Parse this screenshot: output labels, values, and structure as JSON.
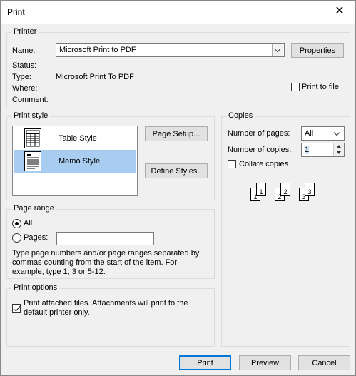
{
  "window": {
    "title": "Print"
  },
  "printer": {
    "group_label": "Printer",
    "name_label": "Name:",
    "name_value": "Microsoft Print to PDF",
    "properties_label": "Properties",
    "status_label": "Status:",
    "type_label": "Type:",
    "type_value": "Microsoft Print To PDF",
    "where_label": "Where:",
    "comment_label": "Comment:",
    "print_to_file_label": "Print to file",
    "print_to_file_checked": false
  },
  "print_style": {
    "group_label": "Print style",
    "styles": [
      {
        "label": "Table Style",
        "selected": false,
        "icon": "table-style-icon"
      },
      {
        "label": "Memo Style",
        "selected": true,
        "icon": "memo-style-icon"
      }
    ],
    "page_setup_label": "Page Setup...",
    "define_styles_label": "Define Styles.."
  },
  "copies": {
    "group_label": "Copies",
    "number_of_pages_label": "Number of pages:",
    "number_of_pages_value": "All",
    "number_of_copies_label": "Number of copies:",
    "number_of_copies_value": "1",
    "collate_label": "Collate copies",
    "collate_checked": false,
    "collate_pages": [
      "1",
      "1",
      "2",
      "2",
      "3",
      "3"
    ]
  },
  "page_range": {
    "group_label": "Page range",
    "all_label": "All",
    "pages_label": "Pages:",
    "selected": "all",
    "help_text": "Type page numbers and/or page ranges separated by commas counting from the start of the item.  For example, type 1, 3 or 5-12."
  },
  "print_options": {
    "group_label": "Print options",
    "print_attached_label": "Print attached files.  Attachments will print to the default printer only.",
    "print_attached_checked": true
  },
  "footer": {
    "print_label": "Print",
    "preview_label": "Preview",
    "cancel_label": "Cancel"
  },
  "colors": {
    "selection": "#a8cdf0",
    "accent": "#0078d7",
    "dialog_bg": "#f0f0f0"
  }
}
